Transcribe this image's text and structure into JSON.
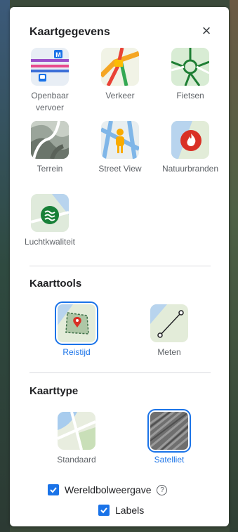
{
  "panel": {
    "title": "Kaartgegevens",
    "close_icon": "close-icon"
  },
  "map_details": {
    "items": [
      {
        "label": "Openbaar vervoer",
        "icon": "transit-icon"
      },
      {
        "label": "Verkeer",
        "icon": "traffic-icon"
      },
      {
        "label": "Fietsen",
        "icon": "biking-icon"
      },
      {
        "label": "Terrein",
        "icon": "terrain-icon"
      },
      {
        "label": "Street View",
        "icon": "street-view-icon"
      },
      {
        "label": "Natuurbranden",
        "icon": "wildfires-icon"
      },
      {
        "label": "Luchtkwaliteit",
        "icon": "air-quality-icon"
      }
    ]
  },
  "map_tools": {
    "title": "Kaarttools",
    "items": [
      {
        "label": "Reistijd",
        "selected": true,
        "icon": "travel-time-icon"
      },
      {
        "label": "Meten",
        "selected": false,
        "icon": "measure-icon"
      }
    ]
  },
  "map_type": {
    "title": "Kaarttype",
    "items": [
      {
        "label": "Standaard",
        "selected": false,
        "icon": "default-map-icon"
      },
      {
        "label": "Satelliet",
        "selected": true,
        "icon": "satellite-map-icon"
      }
    ]
  },
  "options": {
    "globe": {
      "label": "Wereldbolweergave",
      "checked": true,
      "help_icon": "help-icon"
    },
    "labels": {
      "label": "Labels",
      "checked": true
    }
  },
  "colors": {
    "accent": "#1a73e8",
    "text": "#202124",
    "muted": "#5f6368"
  }
}
